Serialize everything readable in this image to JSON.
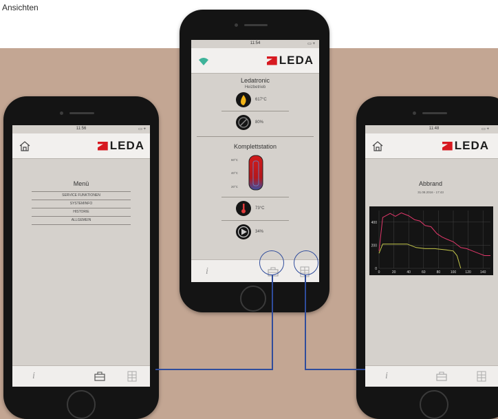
{
  "caption": "Ansichten",
  "colors": {
    "background_band": "#c3a693",
    "brand_red": "#d71920",
    "connector": "#2f4c9c"
  },
  "brand": "LEDA",
  "left_phone": {
    "status_time": "11:56",
    "status_battery": "▭ +",
    "title": "Menü",
    "menu_items": [
      "SERVICE FUNKTIONEN",
      "SYSTEMINFO",
      "HISTORIE",
      "ALLGEMEIN"
    ],
    "tabs": {
      "info_icon": "info-icon",
      "toolbox_icon": "toolbox-icon",
      "grid_icon": "grid-icon"
    }
  },
  "center_phone": {
    "status_time": "11:54",
    "status_battery": "▭ +",
    "section1_title": "Ledatronic",
    "section1_sub": "Heizbetrieb",
    "flame_value": "617°C",
    "damper_value": "80%",
    "section2_title": "Komplettstation",
    "tank_labels": [
      "60°C",
      "40°C",
      "20°C"
    ],
    "sensor_value": "73°C",
    "pump_value": "34%"
  },
  "right_phone": {
    "status_time": "11:48",
    "status_battery": "▭ +",
    "title": "Abbrand",
    "subtitle": "31.08.2016 - 17:43",
    "chart_data": {
      "type": "line",
      "x_ticks": [
        "0",
        "20",
        "40",
        "60",
        "80",
        "100",
        "120",
        "140"
      ],
      "y_ticks": [
        "0",
        "200",
        "400"
      ],
      "xlim": [
        0,
        150
      ],
      "ylim": [
        0,
        500
      ],
      "series": [
        {
          "color": "#e2386b",
          "x": [
            0,
            5,
            15,
            22,
            30,
            40,
            48,
            55,
            62,
            70,
            78,
            85,
            92,
            100,
            110,
            118,
            126,
            134,
            142,
            150
          ],
          "values": [
            150,
            440,
            475,
            450,
            480,
            455,
            420,
            410,
            370,
            360,
            300,
            270,
            250,
            230,
            180,
            170,
            150,
            130,
            110,
            110
          ]
        },
        {
          "color": "#c6c84a",
          "x": [
            0,
            5,
            20,
            38,
            50,
            62,
            75,
            90,
            100,
            105,
            110
          ],
          "values": [
            130,
            210,
            210,
            210,
            180,
            170,
            170,
            160,
            150,
            110,
            0
          ]
        }
      ]
    }
  }
}
